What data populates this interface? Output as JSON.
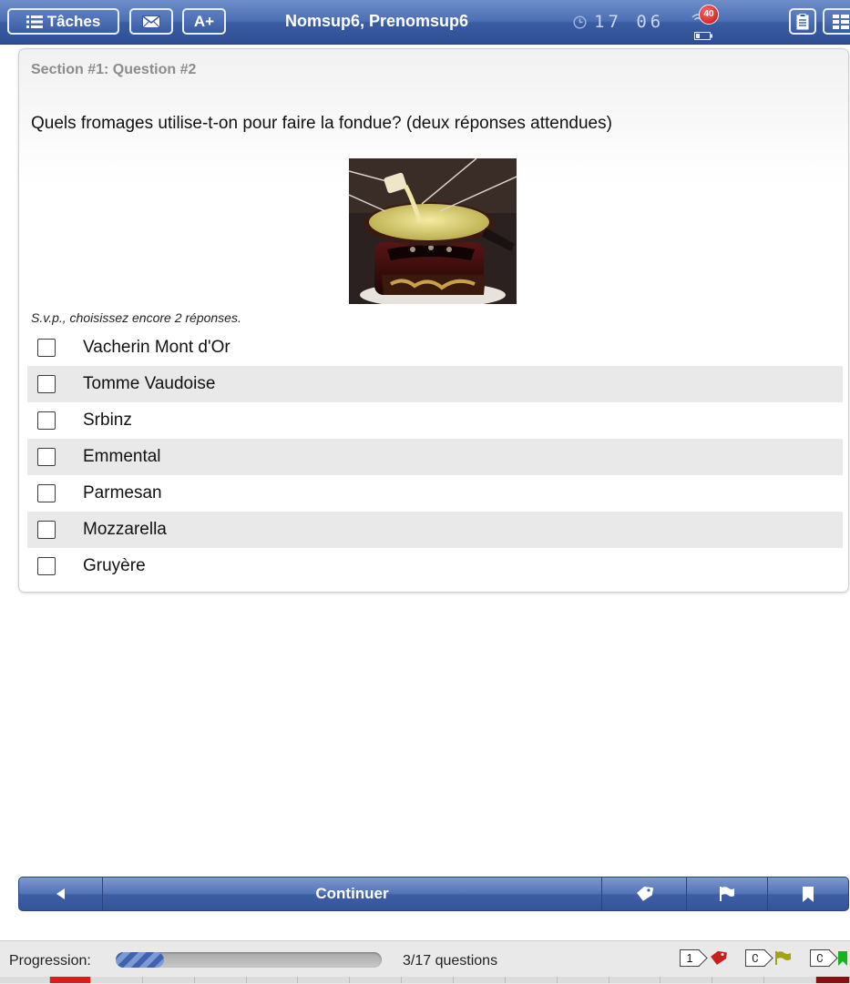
{
  "header": {
    "tasks_label": "Tâches",
    "font_size_label": "A+",
    "student_name": "Nomsup6, Prenomsup6",
    "time": "17 06",
    "notifications_count": "40",
    "icons": {
      "tasks": "list-icon",
      "mail": "envelope-icon",
      "clock": "clock-icon",
      "wifi": "wifi-icon",
      "battery": "battery-icon",
      "notes": "clipboard-icon",
      "overview": "grid-icon"
    }
  },
  "question": {
    "section_label": "Section #1: Question #2",
    "text": "Quels fromages utilise-t-on pour faire la fondue? (deux réponses attendues)",
    "image_alt": "fondue",
    "hint": "S.v.p., choisissez encore 2 réponses.",
    "options": [
      {
        "label": "Vacherin Mont d'Or",
        "checked": false
      },
      {
        "label": "Tomme Vaudoise",
        "checked": false
      },
      {
        "label": "Srbinz",
        "checked": false
      },
      {
        "label": "Emmental",
        "checked": false
      },
      {
        "label": "Parmesan",
        "checked": false
      },
      {
        "label": "Mozzarella",
        "checked": false
      },
      {
        "label": "Gruyère",
        "checked": false
      }
    ]
  },
  "nav": {
    "continue_label": "Continuer",
    "icons": {
      "back": "triangle-left-icon",
      "tag": "tag-icon",
      "flag": "flag-icon",
      "bookmark": "bookmark-icon"
    }
  },
  "progress": {
    "label": "Progression:",
    "fraction": 0.18,
    "count_text": "3/17 questions",
    "tagged_count": "1",
    "flagged_count": "0",
    "bookmarked_count": "0"
  },
  "colors": {
    "bar_top": "#6f8ec9",
    "bar_bottom": "#2f4f94",
    "tag_red": "#c81e1e",
    "flag_olive": "#a3a313",
    "bookmark_green": "#17b31e"
  }
}
